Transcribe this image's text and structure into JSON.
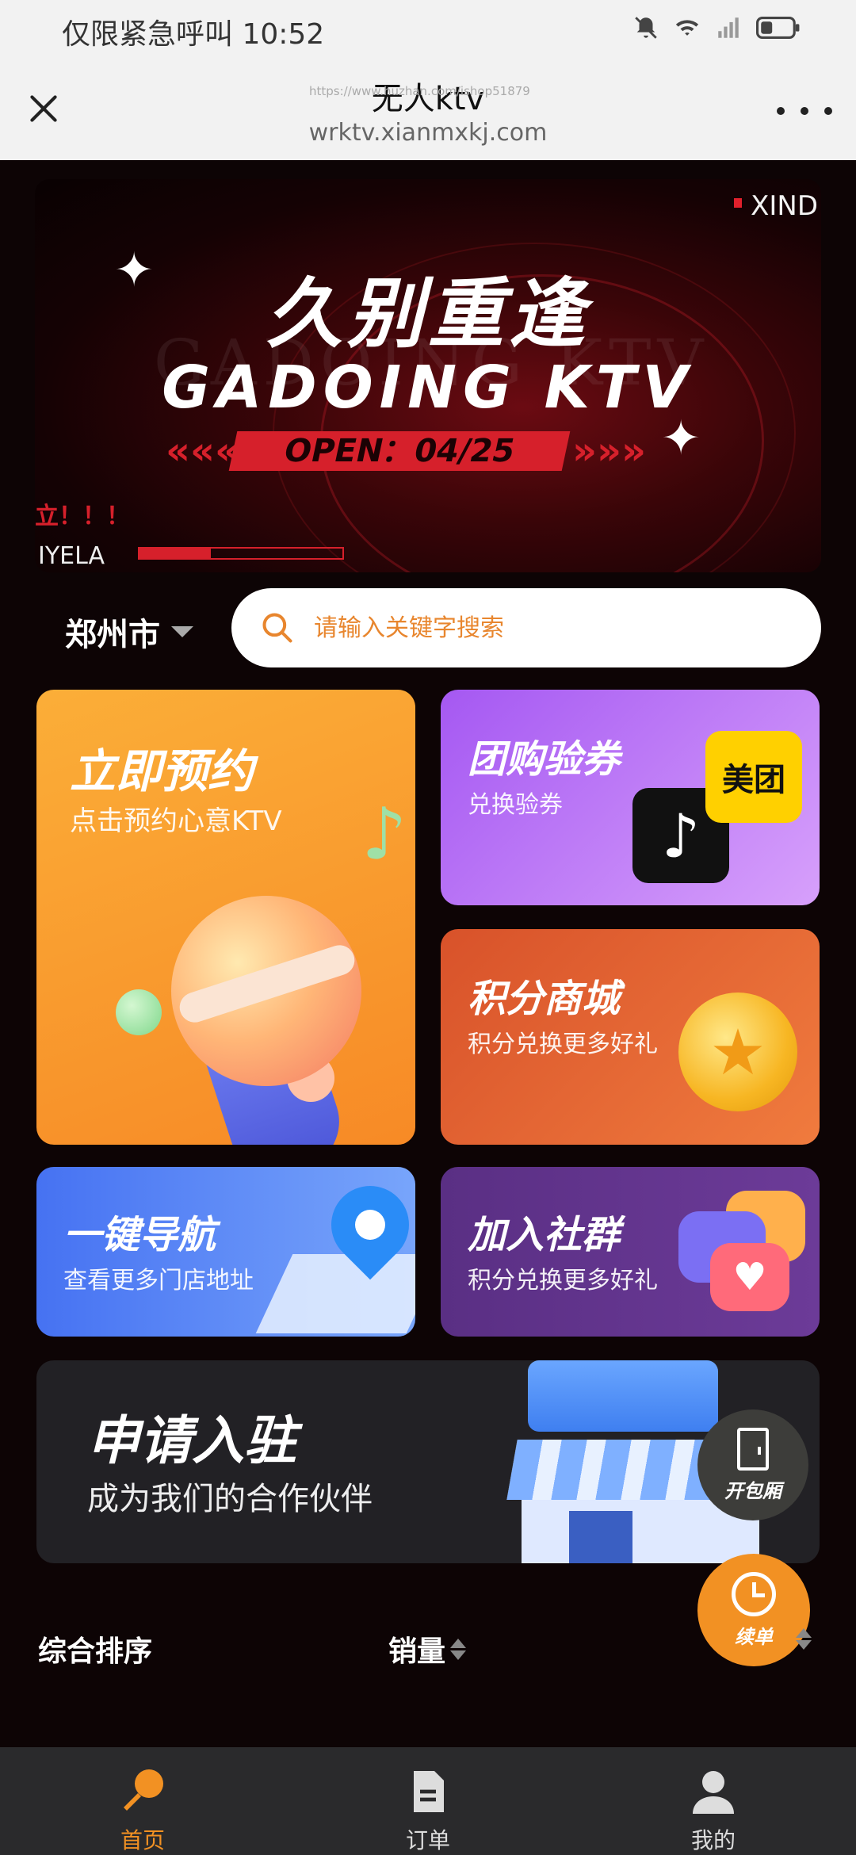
{
  "status_bar": {
    "carrier": "仅限紧急呼叫",
    "time": "10:52",
    "icons": [
      "bell-off-icon",
      "wifi-icon",
      "signal-icon",
      "battery-icon"
    ]
  },
  "header": {
    "title": "无人ktv",
    "url": "wrktv.xianmxkj.com",
    "watermark": "https://www.huzhan.com/ishop51879"
  },
  "banner": {
    "main_title": "久别重逢",
    "sub_title": "GADOING KTV",
    "open_text": "OPEN：04/25",
    "brand_right": "XIND",
    "brand_left": "IYELA",
    "alert_text": "立！！！",
    "progress_fraction": 0.35
  },
  "location": {
    "city": "郑州市"
  },
  "search": {
    "placeholder": "请输入关键字搜索"
  },
  "cards": {
    "book": {
      "title": "立即预约",
      "subtitle": "点击预约心意KTV"
    },
    "group": {
      "title": "团购验券",
      "subtitle": "兑换验券",
      "meituan_label": "美团"
    },
    "points": {
      "title": "积分商城",
      "subtitle": "积分兑换更多好礼"
    },
    "navigate": {
      "title": "一键导航",
      "subtitle": "查看更多门店地址"
    },
    "community": {
      "title": "加入社群",
      "subtitle": "积分兑换更多好礼"
    },
    "join": {
      "title": "申请入驻",
      "subtitle": "成为我们的合作伙伴"
    }
  },
  "floating": {
    "open_room": "开包厢",
    "renew": "续单"
  },
  "sort": {
    "items": [
      "综合排序",
      "销量"
    ]
  },
  "tabbar": {
    "items": [
      {
        "label": "首页",
        "icon": "microphone-icon",
        "active": true
      },
      {
        "label": "订单",
        "icon": "document-icon",
        "active": false
      },
      {
        "label": "我的",
        "icon": "user-icon",
        "active": false
      }
    ]
  },
  "colors": {
    "accent": "#f29123",
    "background": "#0d0405",
    "banner_red": "#d6202b"
  }
}
